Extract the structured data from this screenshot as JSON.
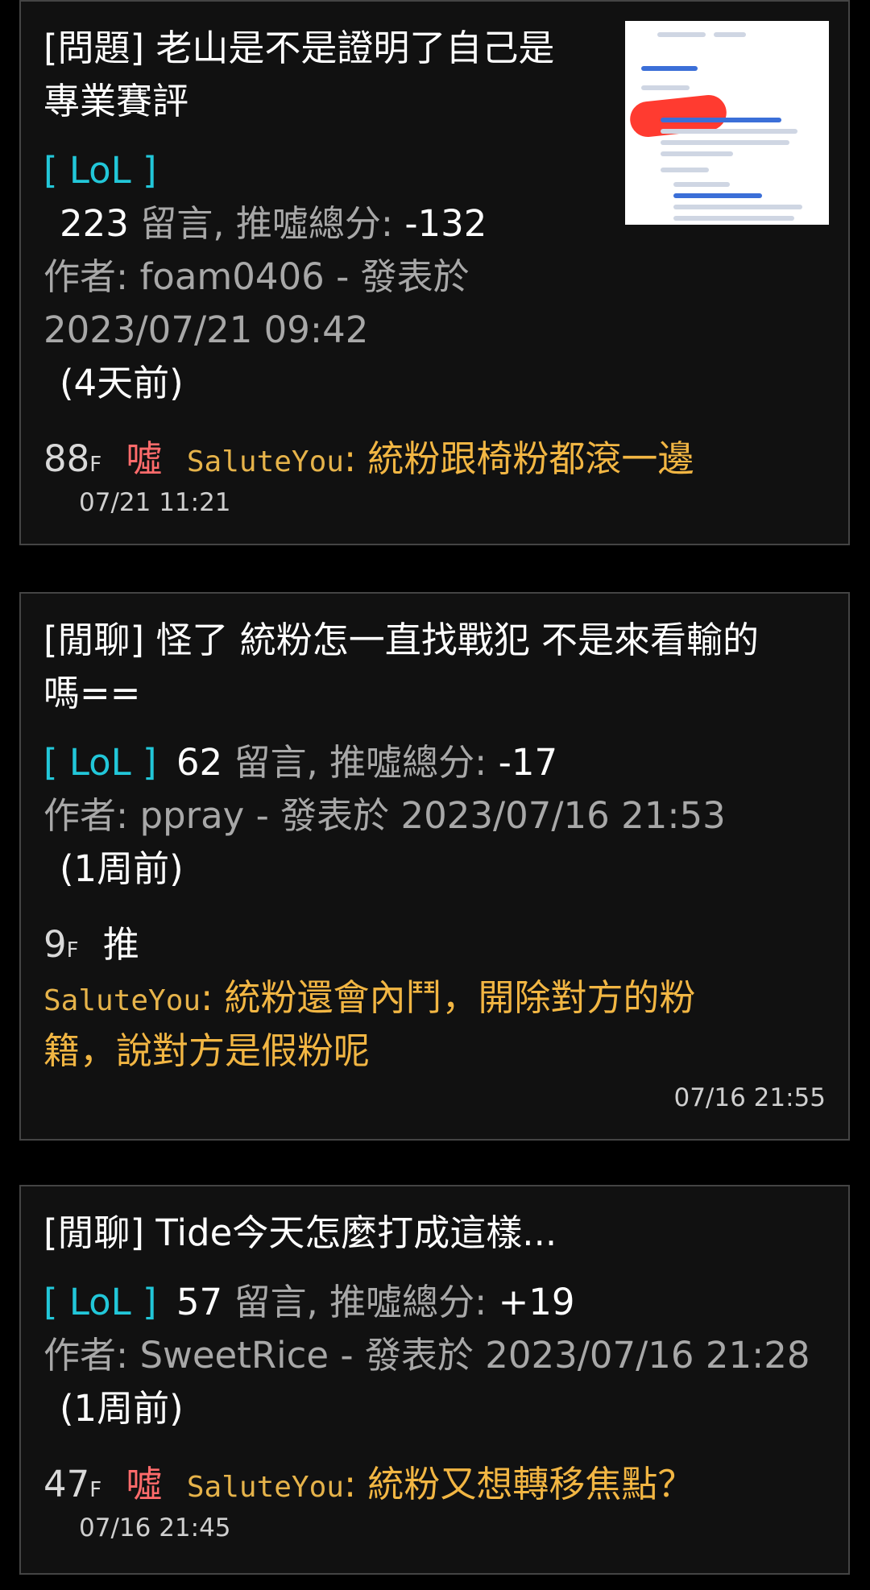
{
  "posts": [
    {
      "title_line1": "[問題] 老山是不是證明了自己是",
      "title_line2": "專業賽評",
      "board": "[ LoL ]",
      "comment_count": "223",
      "comments_label": "留言, 推噓總分:",
      "score": "-132",
      "author_line1": "作者: foam0406 - 發表於",
      "author_line2": "2023/07/21 09:42",
      "ago": "(4天前)",
      "comment": {
        "floor": "88",
        "floor_suffix": "F",
        "tag": "噓",
        "user": "SaluteYou",
        "text": ": 統粉跟椅粉都滾一邊",
        "time": "07/21 11:21"
      }
    },
    {
      "title_line1": "[閒聊] 怪了 統粉怎一直找戰犯 不是來看輸的",
      "title_line2": "嗎==",
      "board": "[ LoL ]",
      "comment_count": "62",
      "comments_label": "留言, 推噓總分:",
      "score": "-17",
      "author_line1": "作者: ppray - 發表於 2023/07/16 21:53",
      "ago": "(1周前)",
      "comment": {
        "floor": "9",
        "floor_suffix": "F",
        "tag": "推",
        "user": "SaluteYou",
        "text_line1": ": 統粉還會內鬥，開除對方的粉",
        "text_line2": "籍，說對方是假粉呢",
        "time": "07/16 21:55"
      }
    },
    {
      "title_line1": "[閒聊] Tide今天怎麼打成這樣...",
      "board": "[ LoL ]",
      "comment_count": "57",
      "comments_label": "留言, 推噓總分:",
      "score": "+19",
      "author_line1": "作者: SweetRice - 發表於 2023/07/16 21:28",
      "ago": "(1周前)",
      "comment": {
        "floor": "47",
        "floor_suffix": "F",
        "tag": "噓",
        "user": "SaluteYou",
        "text": ": 統粉又想轉移焦點？",
        "time": "07/16 21:45"
      }
    }
  ]
}
